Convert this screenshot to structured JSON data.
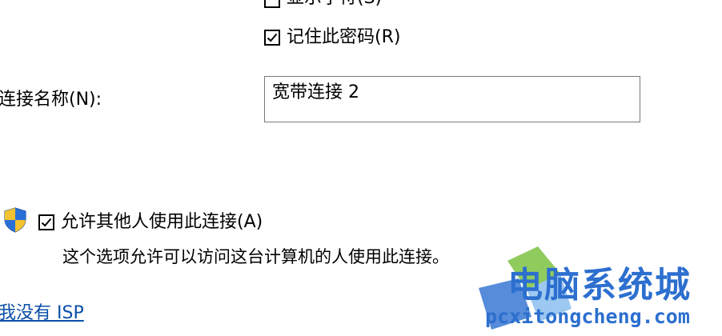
{
  "password_options": {
    "show_chars_label": "显示字符(S)",
    "show_chars_checked": false,
    "remember_password_label": "记住此密码(R)",
    "remember_password_checked": true
  },
  "connection_name": {
    "label": "连接名称(N):",
    "value": "宽带连接 2"
  },
  "allow_others": {
    "label": "允许其他人使用此连接(A)",
    "checked": true,
    "description": "这个选项允许可以访问这台计算机的人使用此连接。"
  },
  "no_isp_link": {
    "label": "我没有 ISP"
  },
  "watermark": {
    "title": "电脑系统城",
    "subtitle": "pcxitongcheng.com"
  },
  "colors": {
    "link": "#0a4fa8",
    "watermark_blue": "#2c6fcf",
    "watermark_green": "#7dc242",
    "shield_blue": "#1f5fbf",
    "shield_yellow": "#f2c230"
  },
  "icons": {
    "uac_shield": "uac-shield-icon",
    "checkmark": "checkmark-icon"
  }
}
